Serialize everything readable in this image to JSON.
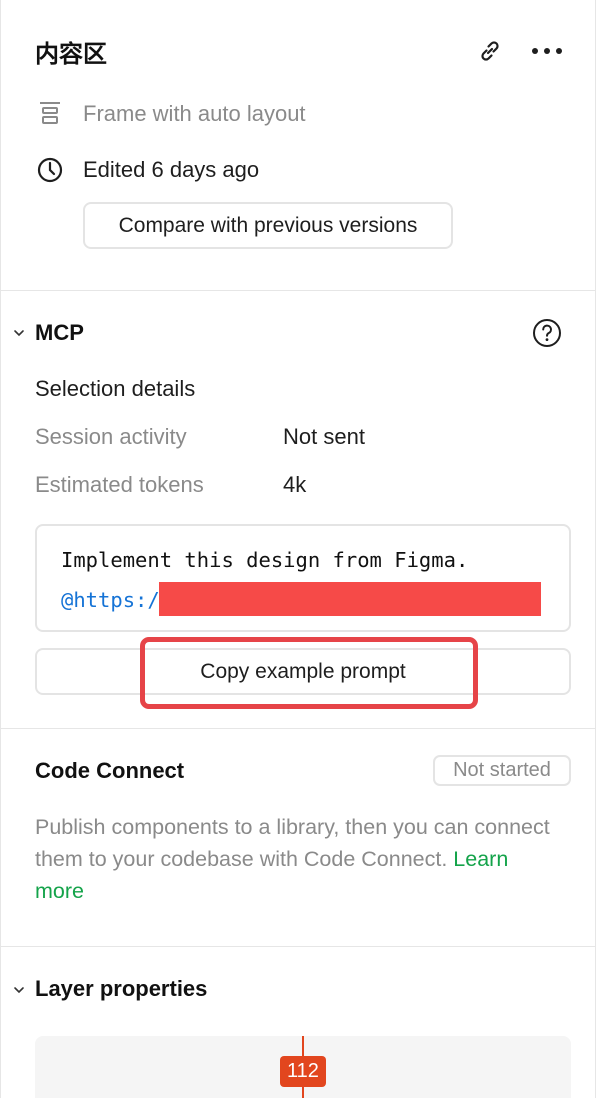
{
  "header": {
    "title": "内容区",
    "frame_type": "Frame with auto layout",
    "edited": "Edited 6 days ago",
    "compare_button": "Compare with previous versions"
  },
  "mcp": {
    "title": "MCP",
    "selection_details": "Selection details",
    "rows": [
      {
        "label": "Session activity",
        "value": "Not sent"
      },
      {
        "label": "Estimated tokens",
        "value": "4k"
      }
    ],
    "prompt_line1": "Implement this design from Figma.",
    "prompt_line2": "@https://",
    "copy_button": "Copy example prompt",
    "highlight_color": "#e64448"
  },
  "code_connect": {
    "title": "Code Connect",
    "status": "Not started",
    "description": "Publish components to a library, then you can connect them to your codebase with Code Connect. ",
    "learn_more": "Learn more"
  },
  "layer_properties": {
    "title": "Layer properties",
    "measurement": "112"
  },
  "colors": {
    "link_green": "#14a34a",
    "code_blue": "#1573d6",
    "measure_orange": "#e2461e",
    "redaction_red": "#f64a48"
  },
  "icons": [
    "link-icon",
    "more-icon",
    "frame-layout-icon",
    "clock-icon",
    "chevron-down-icon",
    "help-icon"
  ]
}
